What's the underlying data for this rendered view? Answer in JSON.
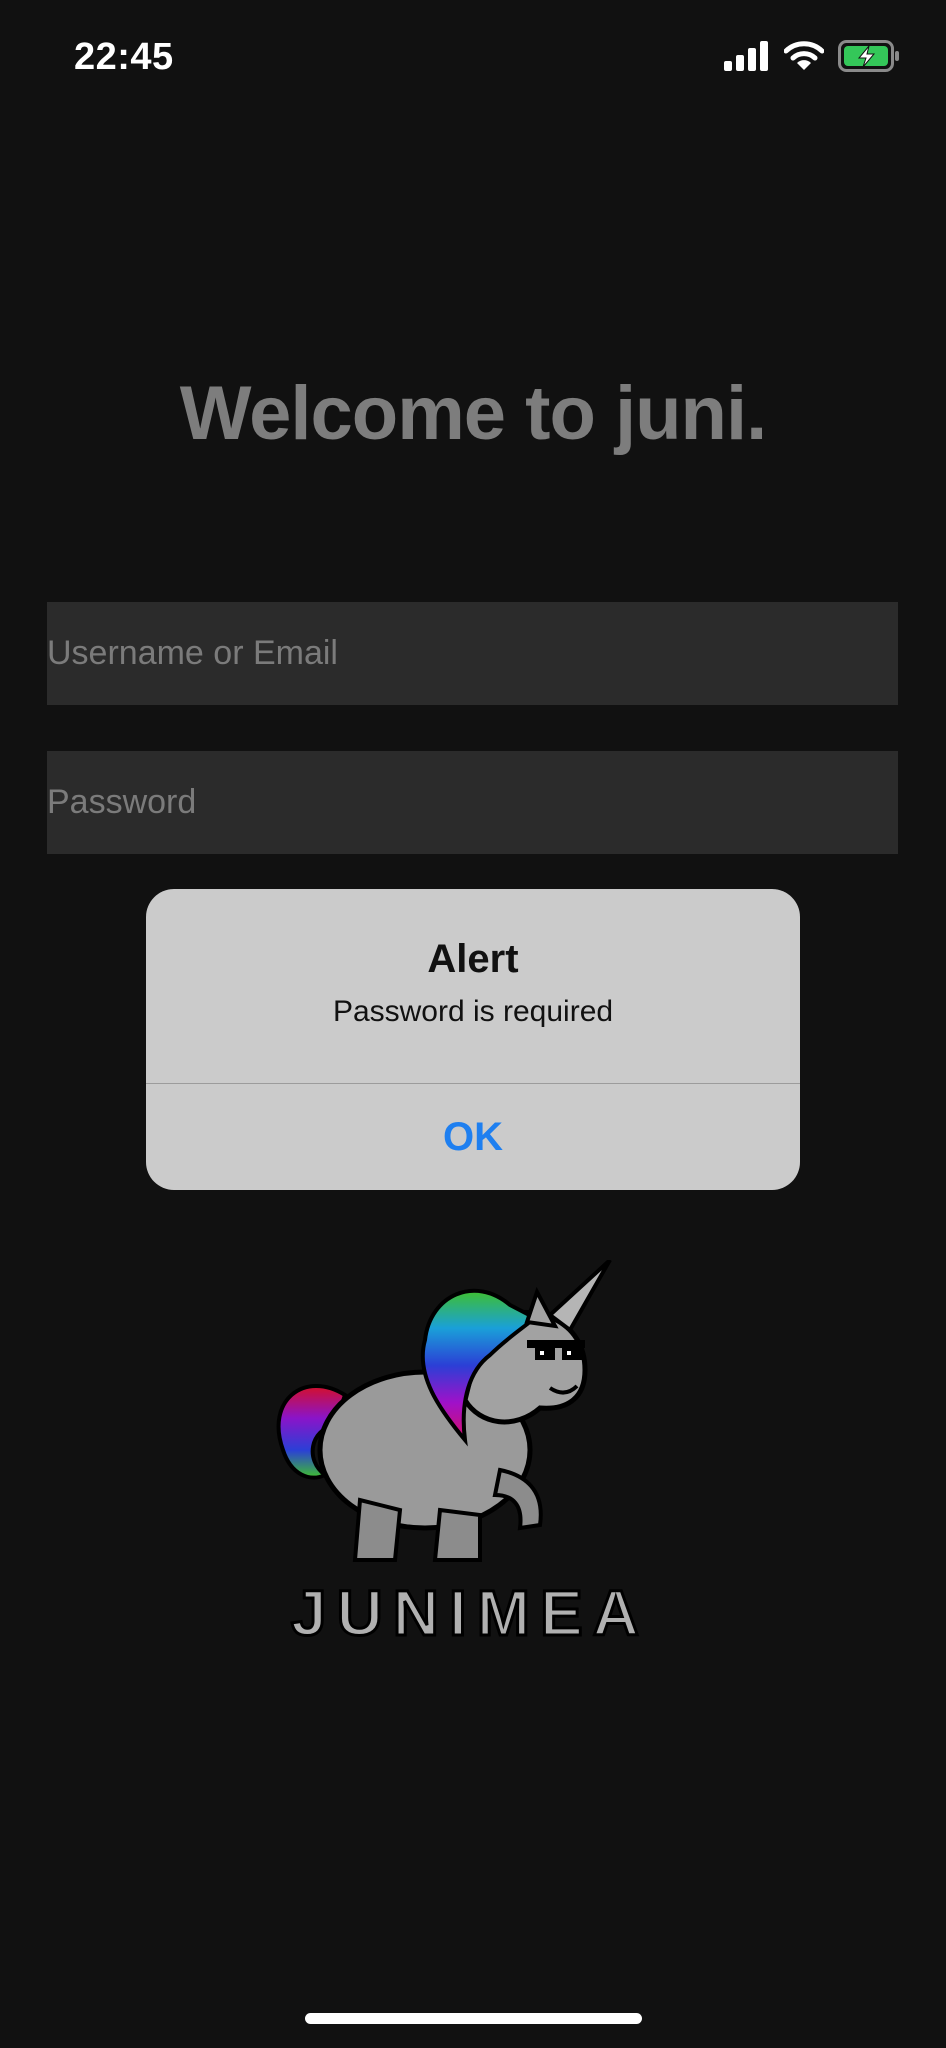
{
  "status_bar": {
    "time": "22:45",
    "icons": [
      "cellular-signal-icon",
      "wifi-icon",
      "battery-charging-icon"
    ],
    "battery_color": "#34c759"
  },
  "login": {
    "title": "Welcome to juni.",
    "username_placeholder": "Username or Email",
    "password_placeholder": "Password"
  },
  "logo": {
    "text": "JUNIMEA",
    "icon": "unicorn-mascot-logo"
  },
  "alert": {
    "title": "Alert",
    "message": "Password is required",
    "ok_label": "OK",
    "accent_color": "#1e7ff0"
  }
}
